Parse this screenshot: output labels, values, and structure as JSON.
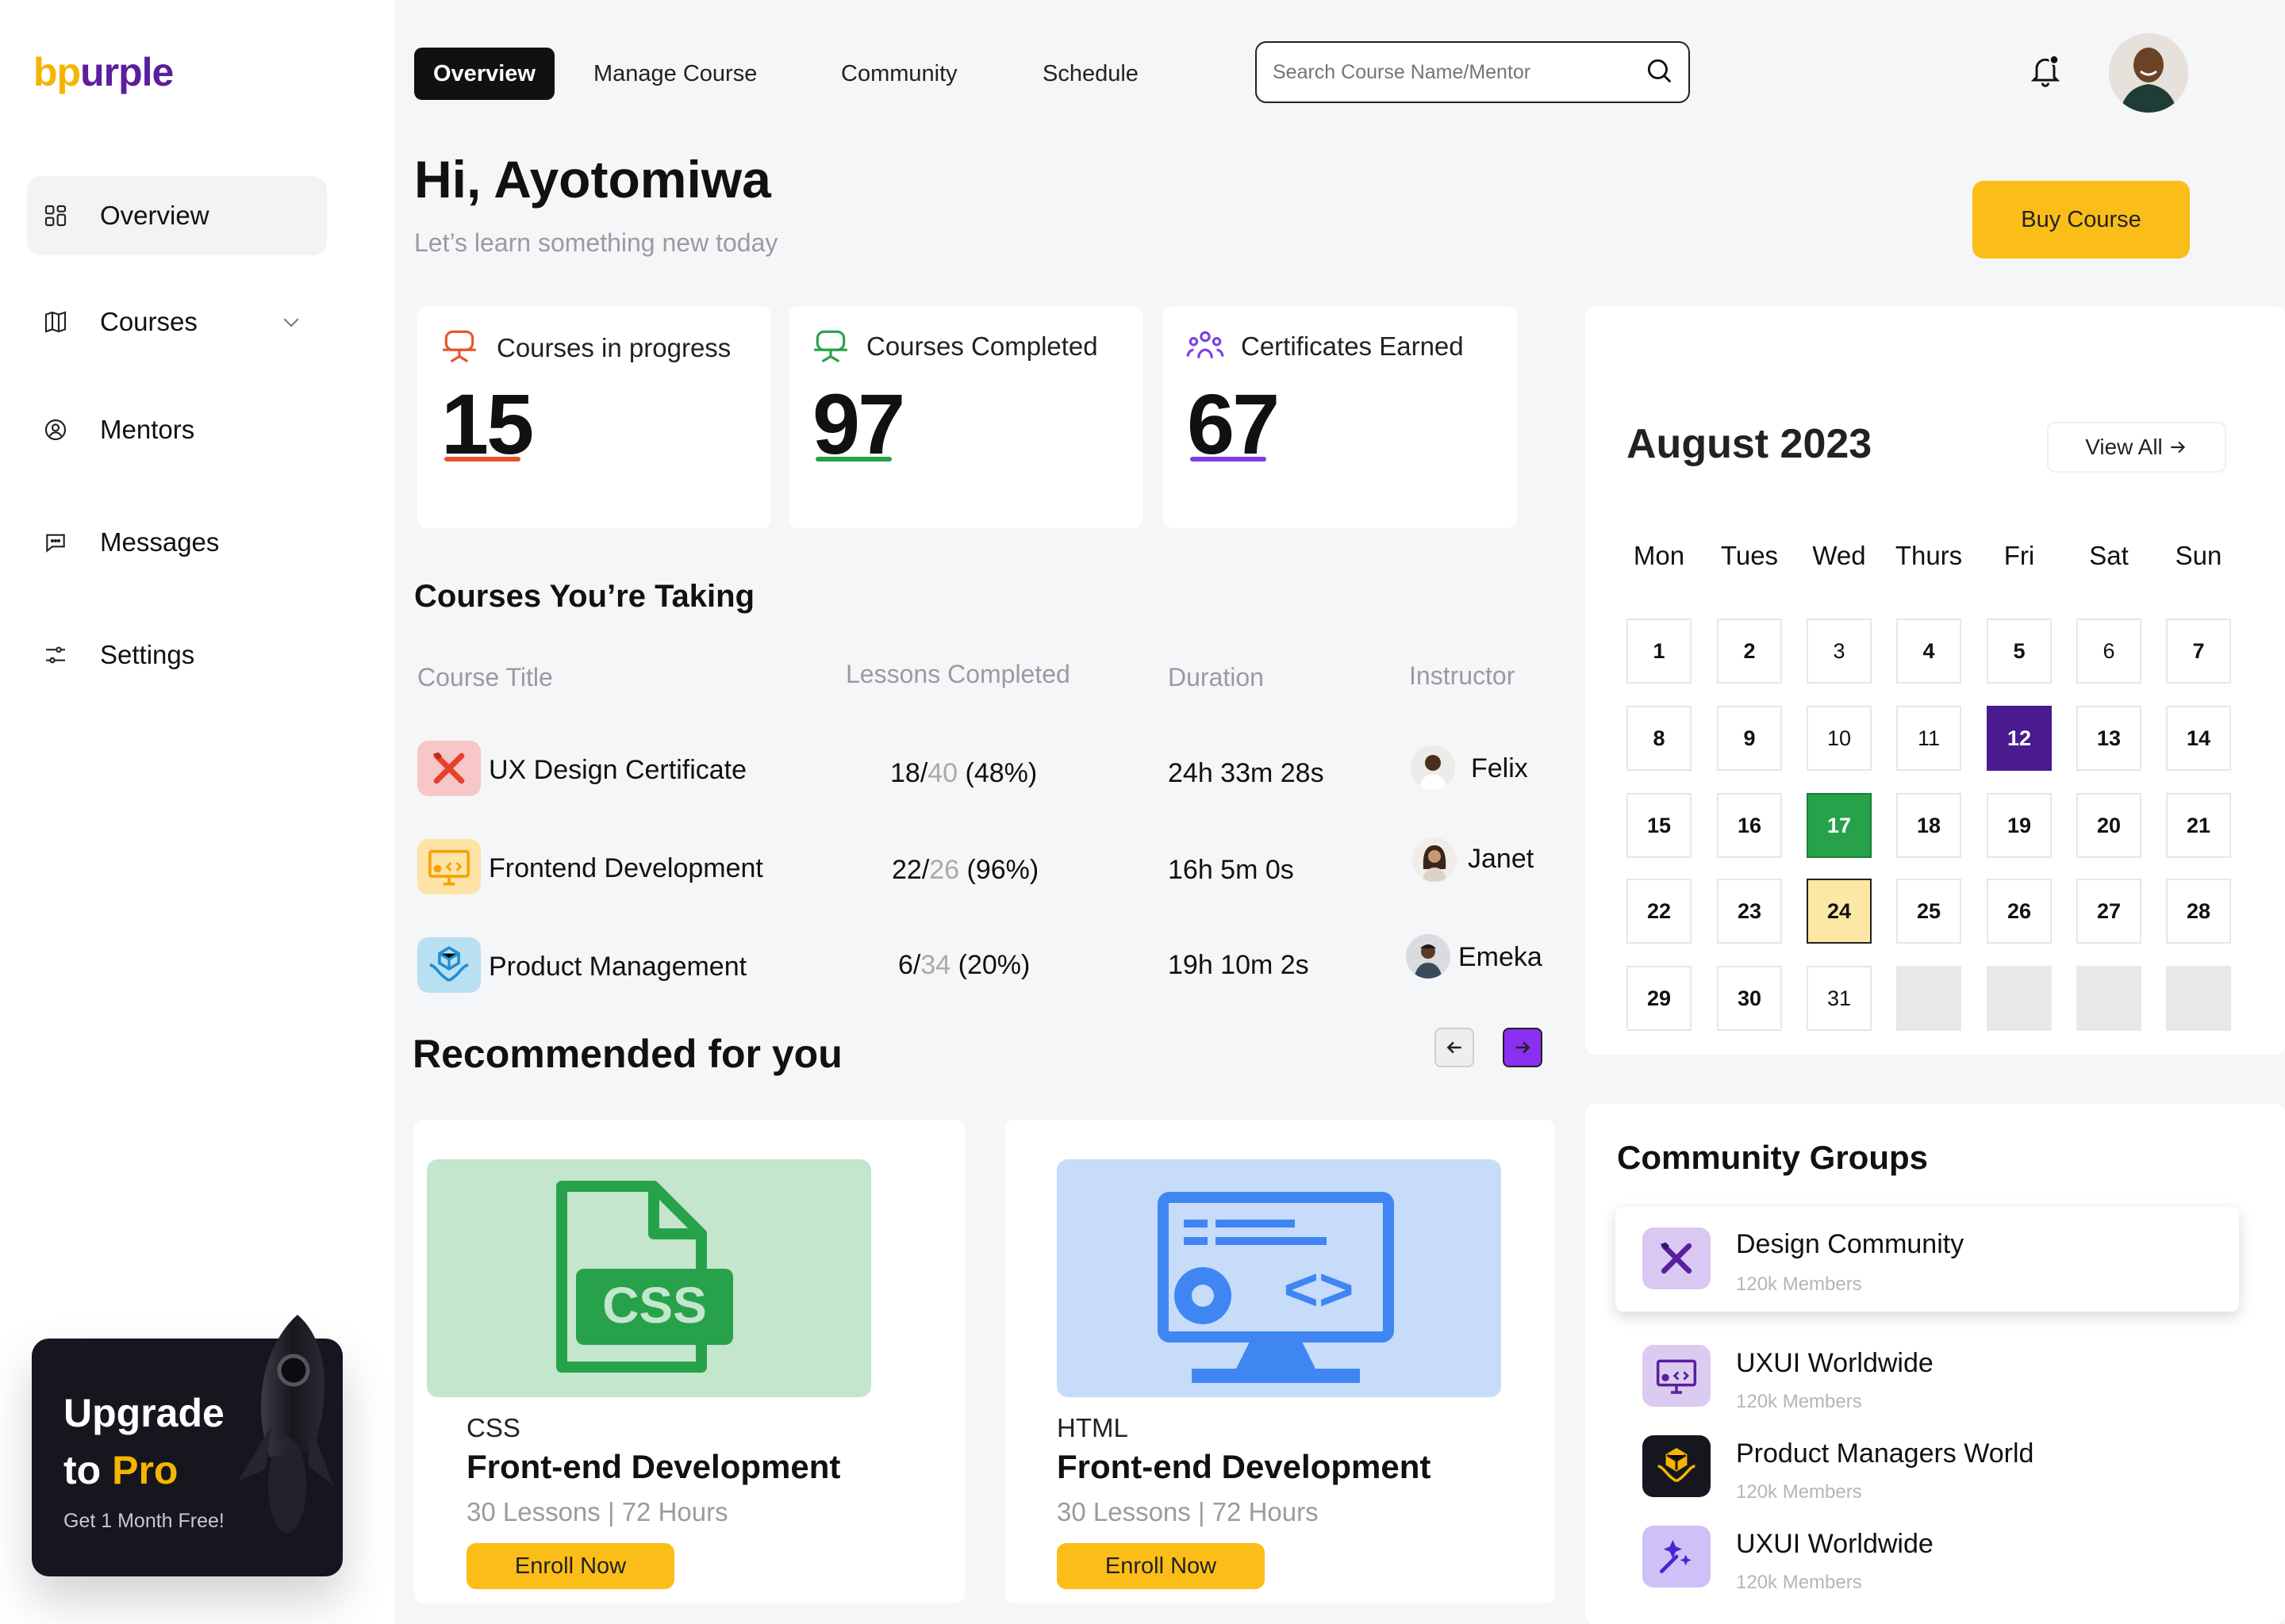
{
  "brand": {
    "logo_part1": "bp",
    "logo_part2": "urple",
    "accent_yellow": "#fbbd17",
    "accent_purple": "#5b1e9e"
  },
  "sidebar": {
    "items": [
      {
        "label": "Overview",
        "icon": "grid-icon"
      },
      {
        "label": "Courses",
        "icon": "book-icon"
      },
      {
        "label": "Mentors",
        "icon": "user-circle-icon"
      },
      {
        "label": "Messages",
        "icon": "chat-icon"
      },
      {
        "label": "Settings",
        "icon": "sliders-icon"
      }
    ],
    "upgrade": {
      "line1": "Upgrade",
      "line2a": "to ",
      "line2b": "Pro",
      "note": "Get 1 Month Free!"
    }
  },
  "topnav": {
    "tabs": [
      "Overview",
      "Manage Course",
      "Community",
      "Schedule"
    ],
    "search_placeholder": "Search Course Name/Mentor"
  },
  "header": {
    "greeting": "Hi, Ayotomiwa",
    "subtitle": "Let’s learn something new today",
    "buy_label": "Buy Course"
  },
  "stats": [
    {
      "label": "Courses in progress",
      "value": "15",
      "color": "#e8532b"
    },
    {
      "label": "Courses Completed",
      "value": "97",
      "color": "#27a24b"
    },
    {
      "label": "Certificates Earned",
      "value": "67",
      "color": "#7b3fe4"
    }
  ],
  "courses": {
    "title": "Courses You’re Taking",
    "headers": [
      "Course Title",
      "Lessons Completed",
      "Duration",
      "Instructor"
    ],
    "rows": [
      {
        "title": "UX Design Certificate",
        "done": "18/",
        "total": "40",
        "pct": " (48%)",
        "duration": "24h 33m 28s",
        "instructor": "Felix"
      },
      {
        "title": "Frontend Development",
        "done": "22/",
        "total": "26",
        "pct": " (96%)",
        "duration": "16h 5m 0s",
        "instructor": "Janet"
      },
      {
        "title": "Product Management",
        "done": "6/",
        "total": "34",
        "pct": " (20%)",
        "duration": "19h 10m 2s",
        "instructor": "Emeka"
      }
    ]
  },
  "recommended": {
    "title": "Recommended for you",
    "cards": [
      {
        "category": "CSS",
        "title": "Front-end Development",
        "meta": "30 Lessons | 72 Hours",
        "cta": "Enroll Now",
        "badge": "CSS"
      },
      {
        "category": "HTML",
        "title": "Front-end Development",
        "meta": "30 Lessons | 72 Hours",
        "cta": "Enroll Now",
        "badge": "<>"
      }
    ]
  },
  "calendar": {
    "title": "August 2023",
    "view_all": "View All",
    "days_of_week": [
      "Mon",
      "Tues",
      "Wed",
      "Thurs",
      "Fri",
      "Sat",
      "Sun"
    ],
    "days": [
      "1",
      "2",
      "3",
      "4",
      "5",
      "6",
      "7",
      "8",
      "9",
      "10",
      "11",
      "12",
      "13",
      "14",
      "15",
      "16",
      "17",
      "18",
      "19",
      "20",
      "21",
      "22",
      "23",
      "24",
      "25",
      "26",
      "27",
      "28",
      "29",
      "30",
      "31"
    ],
    "selected": "12",
    "highlight_green": "17",
    "highlight_yellow": "24"
  },
  "community": {
    "title": "Community Groups",
    "groups": [
      {
        "name": "Design Community",
        "members": "120k Members"
      },
      {
        "name": "UXUI Worldwide",
        "members": "120k Members"
      },
      {
        "name": "Product Managers World",
        "members": "120k Members"
      },
      {
        "name": "UXUI Worldwide",
        "members": "120k Members"
      }
    ]
  }
}
